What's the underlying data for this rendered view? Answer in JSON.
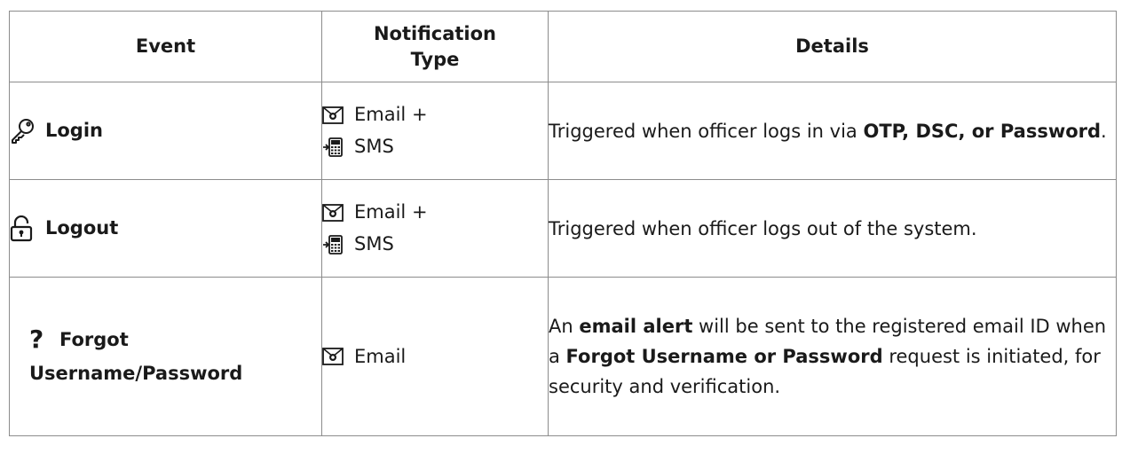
{
  "table": {
    "headers": {
      "event": "Event",
      "notification_type_line1": "Notification",
      "notification_type_line2": "Type",
      "details": "Details"
    },
    "rows": [
      {
        "icon": "key-icon",
        "event": "Login",
        "notification": [
          "Email +",
          "SMS"
        ],
        "notification_icons": [
          "envelope-icon",
          "mobile-phone-icon"
        ],
        "details_parts": [
          "Triggered when officer logs in via ",
          "OTP, DSC, or Password",
          "."
        ]
      },
      {
        "icon": "unlock-icon",
        "event": "Logout",
        "notification": [
          "Email +",
          "SMS"
        ],
        "notification_icons": [
          "envelope-icon",
          "mobile-phone-icon"
        ],
        "details_parts": [
          "Triggered when officer logs out of the system."
        ]
      },
      {
        "icon": "question-mark-icon",
        "event_line1": "Forgot",
        "event_line2": "Username/Password",
        "notification": [
          "Email"
        ],
        "notification_icons": [
          "envelope-icon"
        ],
        "details_parts": [
          "An ",
          "email alert",
          " will be sent to the registered email ID when a ",
          "Forgot Username or Password",
          " request is initiated, for security and verification."
        ]
      }
    ]
  }
}
